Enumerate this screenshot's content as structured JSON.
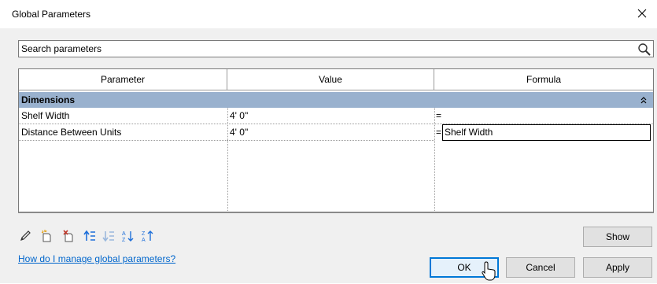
{
  "window": {
    "title": "Global Parameters"
  },
  "search": {
    "placeholder": "Search parameters"
  },
  "table": {
    "columns": [
      "Parameter",
      "Value",
      "Formula"
    ],
    "group": "Dimensions",
    "rows": [
      {
        "parameter": "Shelf Width",
        "value": "4'  0\"",
        "formula": ""
      },
      {
        "parameter": "Distance Between Units",
        "value": "4'  0\"",
        "formula": "Shelf Width"
      }
    ],
    "formula_prefix": "="
  },
  "toolbar": {
    "icons": [
      "edit-pencil-icon",
      "new-parameter-icon",
      "delete-parameter-icon",
      "move-up-icon",
      "move-down-icon",
      "sort-ascending-icon",
      "sort-descending-icon"
    ]
  },
  "help_link": "How do I manage global parameters?",
  "buttons": {
    "show": "Show",
    "ok": "OK",
    "cancel": "Cancel",
    "apply": "Apply"
  },
  "colors": {
    "group_header": "#99b1ce",
    "link": "#0066cc",
    "icon_blue": "#1e6fd9",
    "icon_red": "#c0392b",
    "client_bg": "#f0f0f0"
  }
}
